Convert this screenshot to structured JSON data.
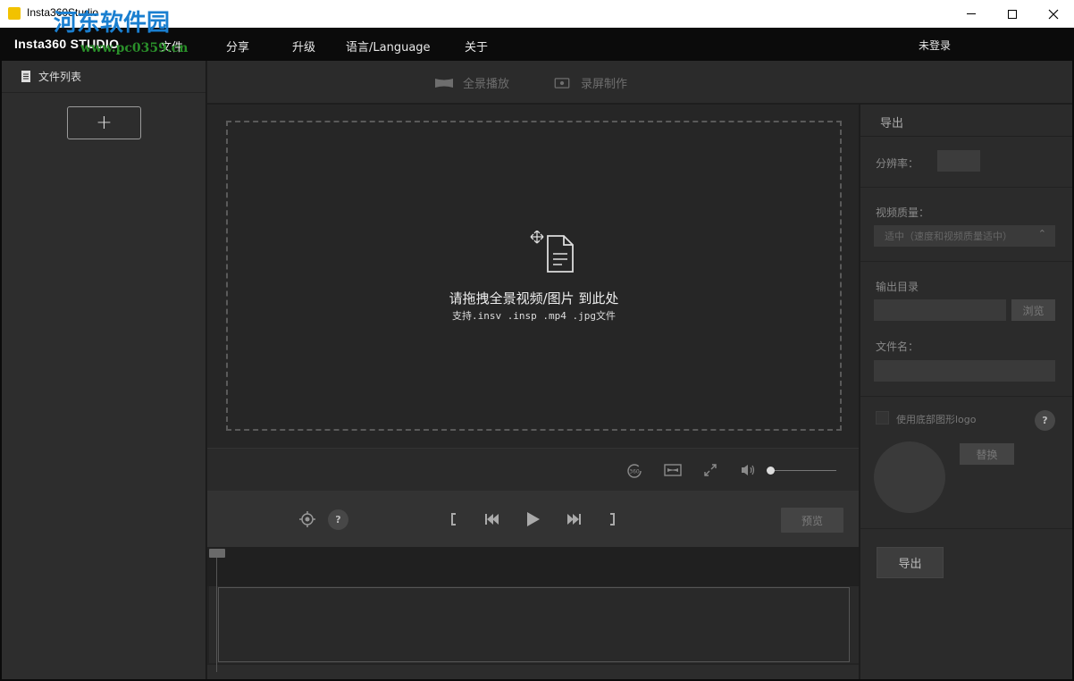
{
  "window": {
    "title": "Insta360Studio",
    "minimize_icon": "minimize-icon",
    "maximize_icon": "maximize-icon",
    "close_icon": "close-icon"
  },
  "menubar": {
    "logo": "Insta360 STUDIO",
    "watermark": "河东软件园",
    "watermark_url": "www.pc0359.cn",
    "items": [
      "文件",
      "分享",
      "升级",
      "语言/Language",
      "关于"
    ],
    "login": "未登录"
  },
  "sidebar": {
    "title": "文件列表",
    "add_label": "+"
  },
  "modes": {
    "panorama": "全景播放",
    "record": "录屏制作"
  },
  "dropzone": {
    "title": "请拖拽全景视频/图片 到此处",
    "subtitle": "支持.insv .insp .mp4 .jpg文件"
  },
  "player_controls": {
    "icons": [
      "rotate-360-icon",
      "aspect-ratio-icon",
      "fullscreen-icon",
      "volume-icon"
    ],
    "volume": 0.0
  },
  "playback": {
    "help": "?",
    "preview": "预览",
    "icons": [
      "locate-icon",
      "mark-in-icon",
      "prev-frame-icon",
      "play-icon",
      "next-frame-icon",
      "mark-out-icon"
    ]
  },
  "export_panel": {
    "title": "导出",
    "resolution_label": "分辨率：",
    "quality_label": "视频质量：",
    "quality_value": "适中（速度和视频质量适中）",
    "output_dir_label": "输出目录",
    "browse": "浏览",
    "filename_label": "文件名：",
    "logo_checkbox_label": "使用底部图形logo",
    "help": "?",
    "change": "替换",
    "export": "导出"
  }
}
